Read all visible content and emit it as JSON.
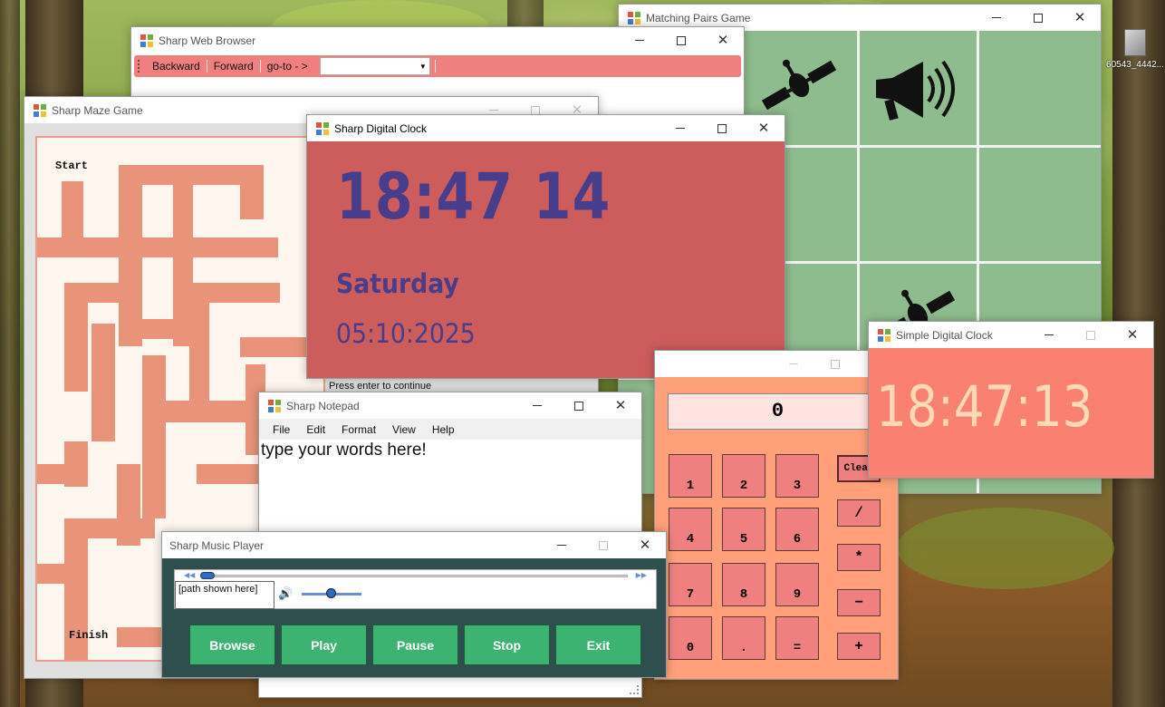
{
  "desktop": {
    "shortcut_label": "60543_4442..."
  },
  "browser": {
    "title": "Sharp Web Browser",
    "toolbar": {
      "backward": "Backward",
      "forward": "Forward",
      "goto": "go-to - >",
      "address_value": ""
    }
  },
  "matching": {
    "title": "Matching Pairs Game"
  },
  "maze": {
    "title": "Sharp Maze Game",
    "start_label": "Start",
    "finish_label": "Finish"
  },
  "clock": {
    "title": "Sharp Digital Clock",
    "time": "18:47 14",
    "day": "Saturday",
    "date": "05:10:2025",
    "hint": "Press enter to continue"
  },
  "simple_clock": {
    "title": "Simple Digital Clock",
    "time": "18:47:13"
  },
  "calculator": {
    "display": "0",
    "keys": {
      "k1": "1",
      "k2": "2",
      "k3": "3",
      "k4": "4",
      "k5": "5",
      "k6": "6",
      "k7": "7",
      "k8": "8",
      "k9": "9",
      "k0": "0",
      "dot": ".",
      "equals": "=",
      "clear": "Clear",
      "divide": "/",
      "multiply": "*",
      "minus": "−",
      "plus": "+"
    }
  },
  "notepad": {
    "title": "Sharp Notepad",
    "menu": {
      "file": "File",
      "edit": "Edit",
      "format": "Format",
      "view": "View",
      "help": "Help"
    },
    "text": "type your words here!"
  },
  "music": {
    "title": "Sharp Music Player",
    "path_text": "[path shown here]",
    "buttons": {
      "browse": "Browse",
      "play": "Play",
      "pause": "Pause",
      "stop": "Stop",
      "exit": "Exit"
    }
  },
  "colors": {
    "clock_bg": "#cd5c5c",
    "clock_text": "#483d8b",
    "match_bg": "#8fbc8f",
    "calc_bg": "#ffa07a",
    "simple_clock_bg": "#fa8072",
    "music_bg": "#2f4f4f",
    "music_button": "#3cb371",
    "browser_toolbar": "#f08080"
  }
}
